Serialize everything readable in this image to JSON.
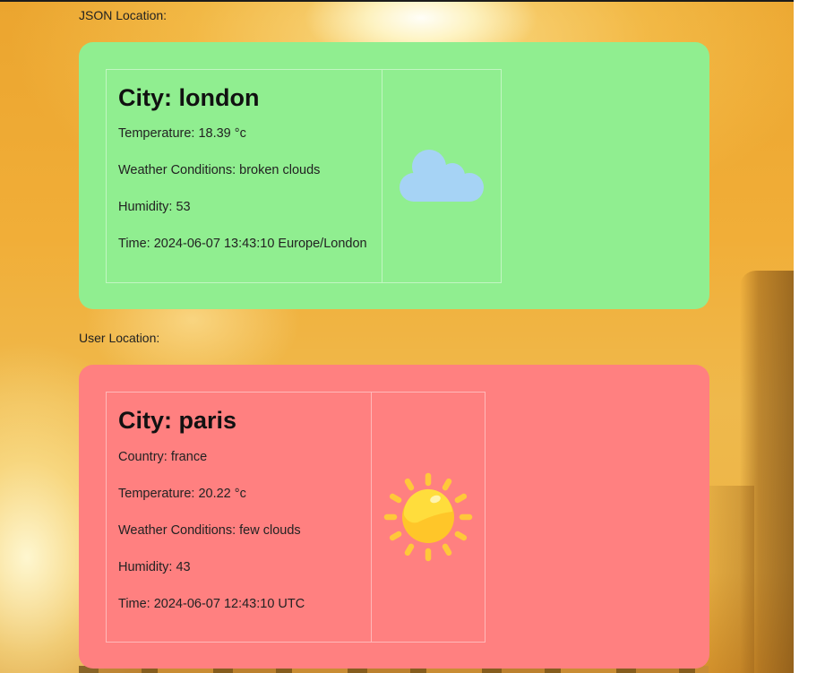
{
  "json_location": {
    "label": "JSON Location:",
    "city_line": "City: london",
    "rows": [
      "Temperature: 18.39 °c",
      "Weather Conditions: broken clouds",
      "Humidity: 53",
      "Time: 2024-06-07 13:43:10 Europe/London"
    ],
    "weather_icon": "cloud-icon",
    "card_color": "#90ee90"
  },
  "user_location": {
    "label": "User Location:",
    "city_line": "City: paris",
    "rows": [
      "Country: france",
      "Temperature: 20.22 °c",
      "Weather Conditions: few clouds",
      "Humidity: 43",
      "Time: 2024-06-07 12:43:10 UTC"
    ],
    "weather_icon": "sun-icon",
    "card_color": "#ff8080"
  }
}
